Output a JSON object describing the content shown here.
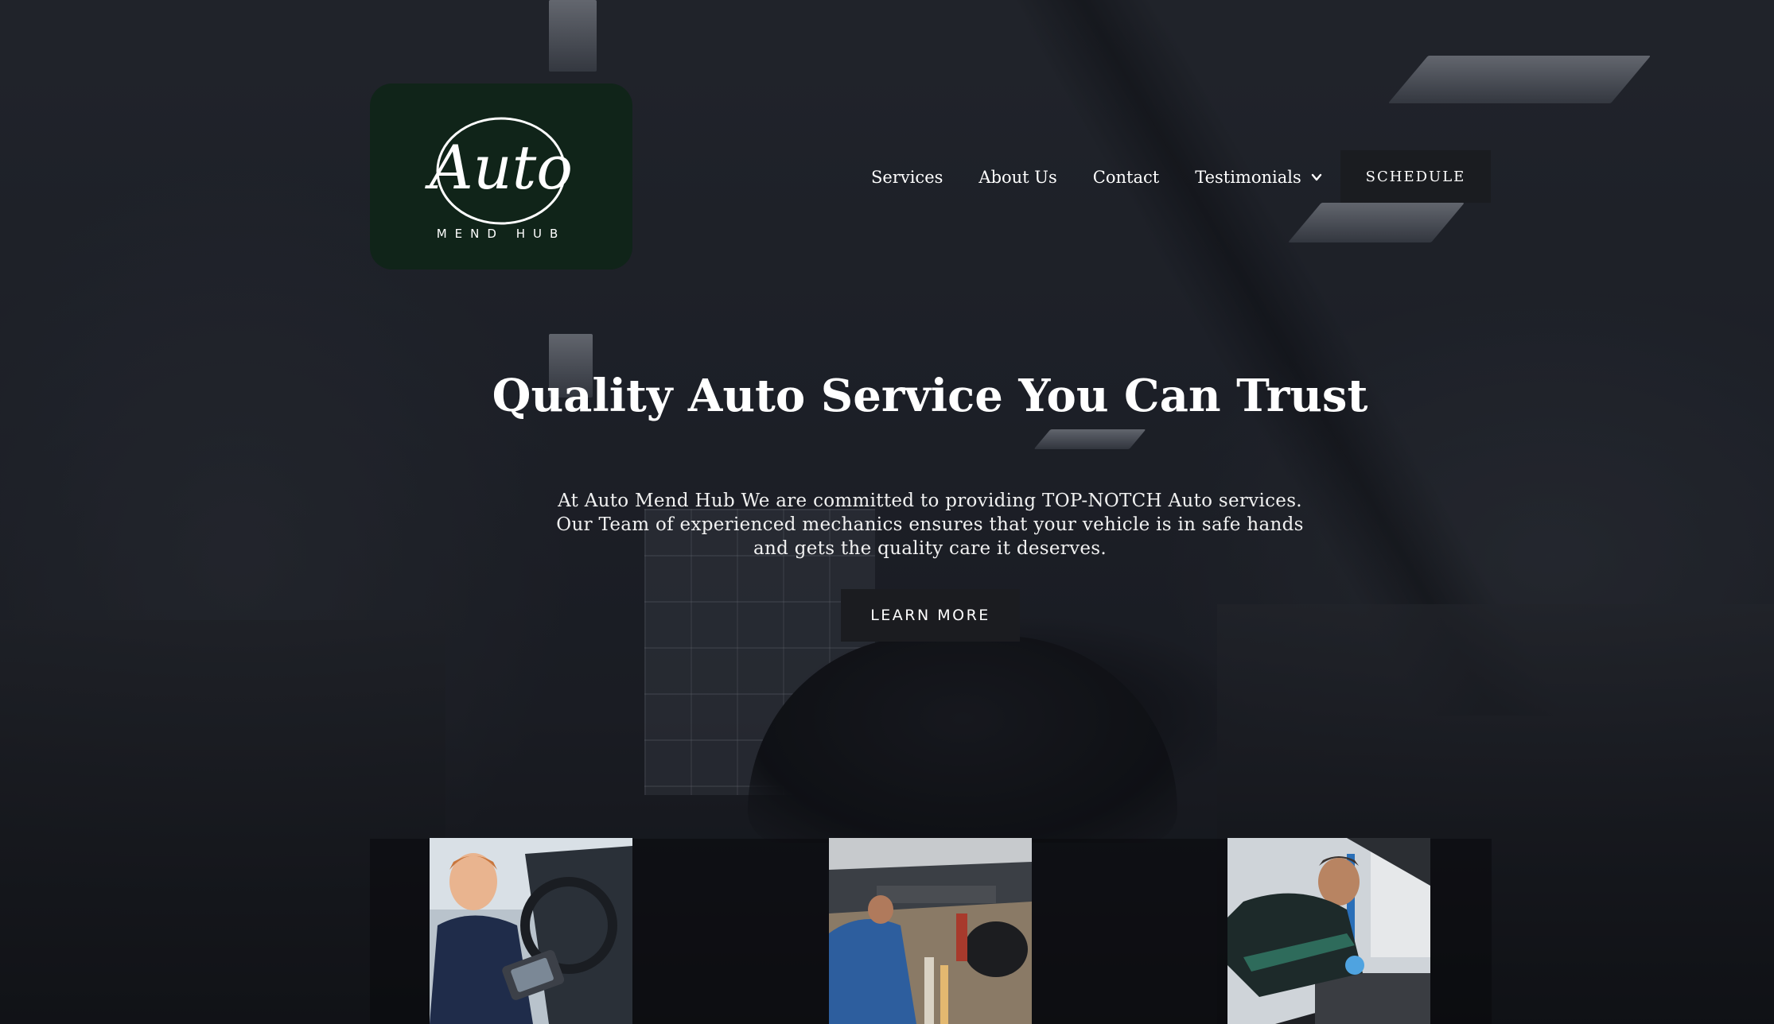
{
  "brand": {
    "logo_script": "Auto",
    "logo_ring_text": "MEND HUB",
    "logo_bg": "#102419"
  },
  "nav": {
    "items": [
      {
        "label": "Services"
      },
      {
        "label": "About Us"
      },
      {
        "label": "Contact"
      },
      {
        "label": "Testimonials",
        "has_dropdown": true,
        "icon": "chevron-down-icon"
      }
    ],
    "cta_label": "SCHEDULE"
  },
  "hero": {
    "title": "Quality Auto Service You Can Trust",
    "subtitle": "At Auto Mend Hub We are committed to providing TOP-NOTCH Auto services. Our Team of experienced mechanics ensures that your vehicle is in safe hands and gets the quality care it deserves.",
    "button_label": "LEARN MORE"
  },
  "cards": [
    {
      "image": "mechanic-with-diagnostic-tool-in-car"
    },
    {
      "image": "mechanic-under-vehicle"
    },
    {
      "image": "mechanic-working-on-engine"
    }
  ],
  "colors": {
    "accent_dark": "#1b1c20",
    "text": "#ffffff"
  }
}
